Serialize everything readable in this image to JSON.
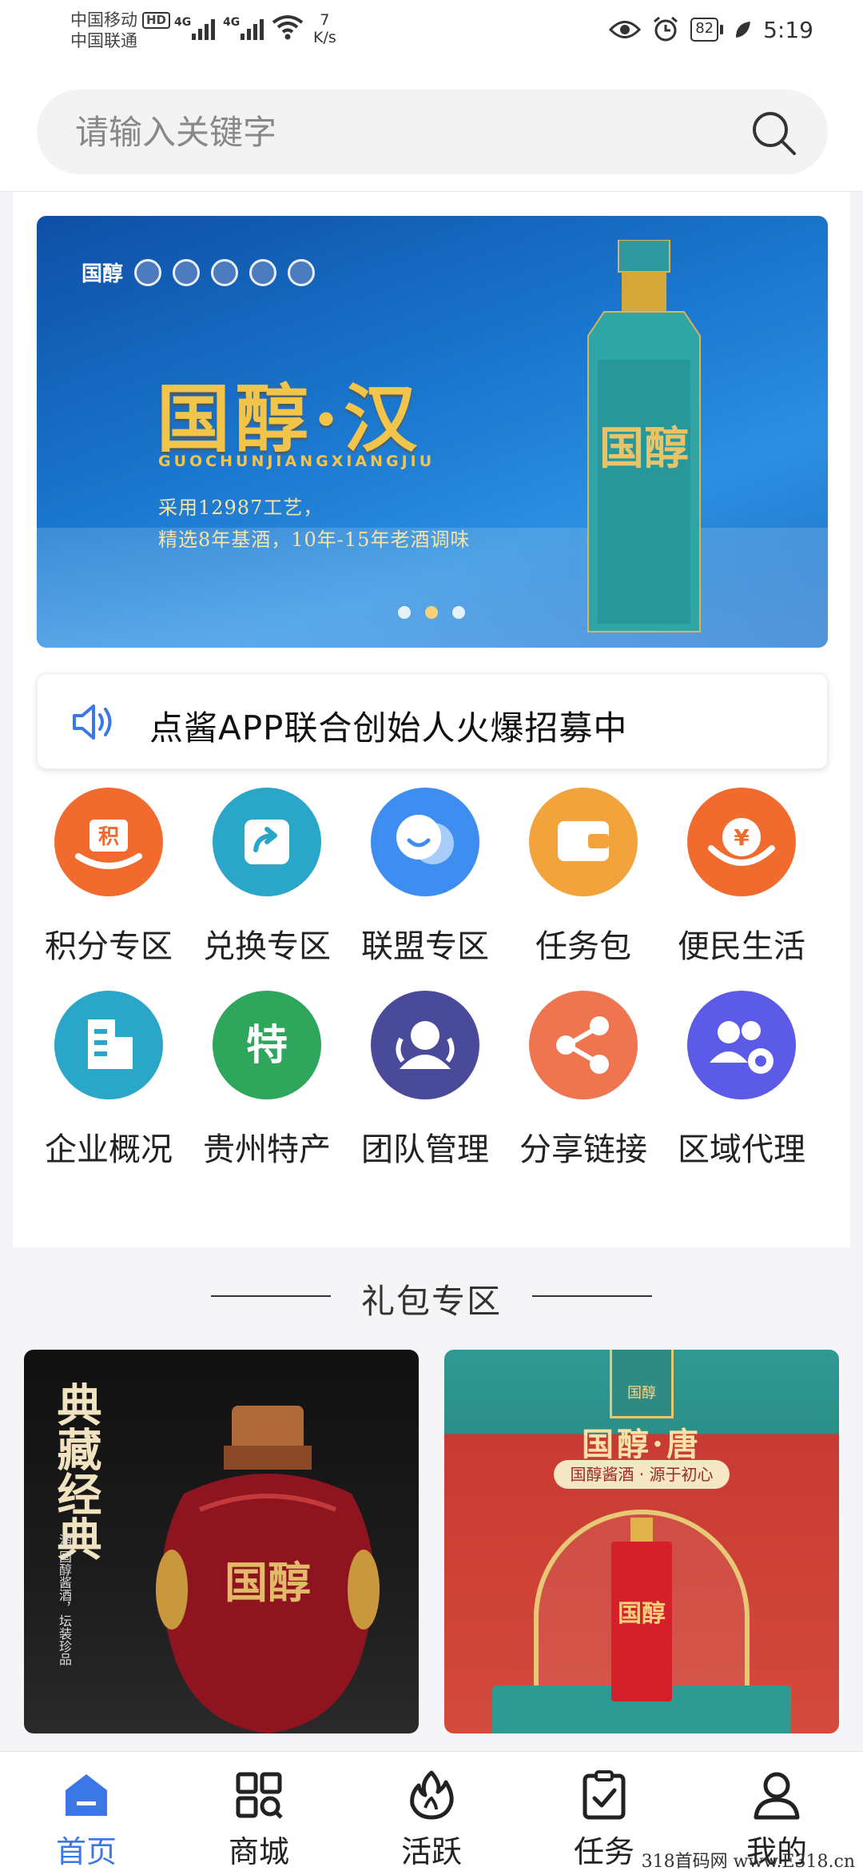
{
  "status_bar": {
    "carrier1": "中国移动",
    "carrier1_badge": "HD",
    "carrier2": "中国联通",
    "net1": "4G",
    "net2": "4G",
    "speed_value": "7",
    "speed_unit": "K/s",
    "battery": "82",
    "time": "5:19"
  },
  "search": {
    "placeholder": "请输入关键字"
  },
  "banner": {
    "brand": "国醇",
    "title": "国醇·汉",
    "pinyin": "GUOCHUNJIANGXIANGJIU",
    "line1": "采用12987工艺，",
    "line2": "精选8年基酒，10年-15年老酒调味",
    "bottle_text": "国醇",
    "dots": 3,
    "active_dot": 1
  },
  "notice": {
    "text": "点酱APP联合创始人火爆招募中"
  },
  "grid": [
    {
      "label": "积分专区",
      "icon": "points-icon",
      "color": "#f26b2e"
    },
    {
      "label": "兑换专区",
      "icon": "exchange-icon",
      "color": "#2aa6c8"
    },
    {
      "label": "联盟专区",
      "icon": "alliance-icon",
      "color": "#3d8ef0"
    },
    {
      "label": "任务包",
      "icon": "wallet-icon",
      "color": "#f3a33b"
    },
    {
      "label": "便民生活",
      "icon": "yuan-icon",
      "color": "#f26b2e"
    },
    {
      "label": "企业概况",
      "icon": "building-icon",
      "color": "#2aa6c8"
    },
    {
      "label": "贵州特产",
      "icon": "specialty-icon",
      "color": "#2ea65c"
    },
    {
      "label": "团队管理",
      "icon": "team-icon",
      "color": "#4a4a9a"
    },
    {
      "label": "分享链接",
      "icon": "share-icon",
      "color": "#ef7450"
    },
    {
      "label": "区域代理",
      "icon": "agent-icon",
      "color": "#5b5be8"
    }
  ],
  "gift_section": {
    "title": "礼包专区"
  },
  "products": [
    {
      "title": "典藏经典",
      "subtitle": "酒 国醇酱酒，坛装珍品",
      "jar_text": "国醇"
    },
    {
      "logo": "国醇",
      "title": "国醇·唐",
      "subtitle": "国醇酱酒 · 源于初心",
      "bottle_text": "国醇"
    }
  ],
  "tabbar": {
    "items": [
      {
        "label": "首页",
        "icon": "home-icon"
      },
      {
        "label": "商城",
        "icon": "mall-icon"
      },
      {
        "label": "活跃",
        "icon": "flame-icon"
      },
      {
        "label": "任务",
        "icon": "task-icon"
      },
      {
        "label": "我的",
        "icon": "profile-icon"
      }
    ],
    "active": 0
  },
  "watermark": "318首码网 www.E318.cn",
  "colors": {
    "accent": "#3b78e6",
    "banner_gold": "#f3c44a"
  }
}
